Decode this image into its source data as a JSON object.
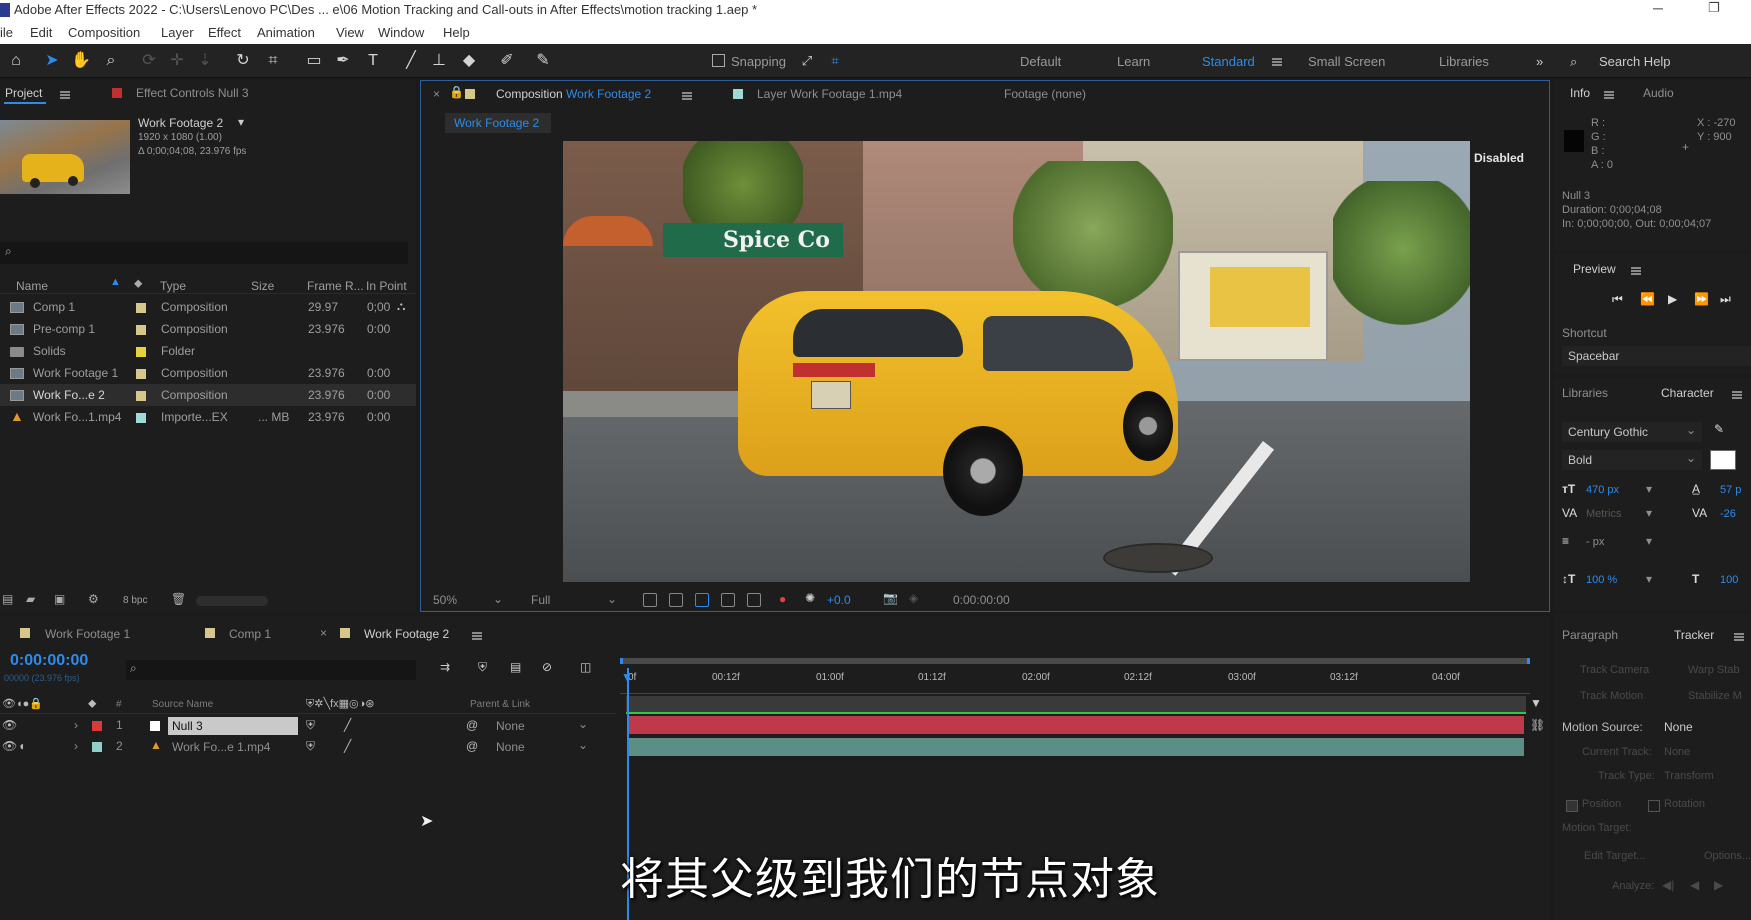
{
  "window": {
    "title": "Adobe After Effects 2022 - C:\\Users\\Lenovo PC\\Des ... e\\06 Motion Tracking and Call-outs in After Effects\\motion tracking 1.aep *"
  },
  "menu": [
    "ile",
    "Edit",
    "Composition",
    "Layer",
    "Effect",
    "Animation",
    "View",
    "Window",
    "Help"
  ],
  "toolbar": {
    "snapping_label": "Snapping",
    "workspaces": [
      "Default",
      "Learn",
      "Standard",
      "Small Screen",
      "Libraries"
    ],
    "active_workspace": "Standard",
    "search_help": "Search Help"
  },
  "project_panel": {
    "tab_project": "Project",
    "tab_effect_controls": "Effect Controls Null 3",
    "selected_name": "Work Footage 2",
    "selected_size": "1920 x 1080 (1.00)",
    "selected_duration": "Δ 0;00;04;08, 23.976 fps",
    "columns": [
      "Name",
      "Type",
      "Size",
      "Frame R...",
      "In Point"
    ],
    "items": [
      {
        "name": "Comp 1",
        "type": "Composition",
        "size": "",
        "rate": "29.97",
        "in": "0;00",
        "color": "#d8c78a",
        "icon": "comp-icon"
      },
      {
        "name": "Pre-comp 1",
        "type": "Composition",
        "size": "",
        "rate": "23.976",
        "in": "0:00",
        "color": "#d8c78a",
        "icon": "comp-icon"
      },
      {
        "name": "Solids",
        "type": "Folder",
        "size": "",
        "rate": "",
        "in": "",
        "color": "#e8d23a",
        "icon": "folder-icon"
      },
      {
        "name": "Work Footage 1",
        "type": "Composition",
        "size": "",
        "rate": "23.976",
        "in": "0:00",
        "color": "#d8c78a",
        "icon": "comp-icon"
      },
      {
        "name": "Work Fo...e 2",
        "type": "Composition",
        "size": "",
        "rate": "23.976",
        "in": "0:00",
        "color": "#d8c78a",
        "icon": "comp-icon"
      },
      {
        "name": "Work Fo...1.mp4",
        "type": "Importe...EX",
        "size": "... MB",
        "rate": "23.976",
        "in": "0:00",
        "color": "#9fd8d4",
        "icon": "footage-icon"
      }
    ],
    "bpc": "8 bpc"
  },
  "composition_panel": {
    "tab_comp_prefix": "Composition",
    "tab_comp_name": "Work Footage 2",
    "tab_layer": "Layer  Work Footage 1.mp4",
    "tab_footage": "Footage  (none)",
    "breadcrumb": "Work Footage 2",
    "disabled_label": "Disabled",
    "zoom": "50%",
    "resolution": "Full",
    "exposure": "+0.0",
    "timecode": "0:00:00:00"
  },
  "info_panel": {
    "tab_info": "Info",
    "tab_audio": "Audio",
    "r": "R :",
    "g": "G :",
    "b": "B :",
    "a": "A : 0",
    "x": "X : -270",
    "y": "Y : 900",
    "layer_name": "Null 3",
    "duration": "Duration: 0;00;04;08",
    "in_out": "In: 0;00;00;00, Out: 0;00;04;07"
  },
  "preview_panel": {
    "title": "Preview",
    "shortcut_label": "Shortcut",
    "shortcut_value": "Spacebar"
  },
  "character_panel": {
    "tab_libraries": "Libraries",
    "tab_character": "Character",
    "font": "Century Gothic",
    "style": "Bold",
    "size": "470 px",
    "leading": "57 p",
    "kerning": "Metrics",
    "tracking": "-26",
    "stroke": "- px",
    "vscale": "100 %",
    "hscale": "100"
  },
  "tracker_panel": {
    "tab_paragraph": "Paragraph",
    "tab_tracker": "Tracker",
    "btn_track_camera": "Track Camera",
    "btn_warp_stab": "Warp Stab",
    "btn_track_motion": "Track Motion",
    "btn_stabilize": "Stabilize M",
    "motion_source_label": "Motion Source:",
    "motion_source_value": "None",
    "current_track_label": "Current Track:",
    "current_track_value": "None",
    "track_type_label": "Track Type:",
    "track_type_value": "Transform",
    "position": "Position",
    "rotation": "Rotation",
    "motion_target": "Motion Target:",
    "edit_target": "Edit Target...",
    "options": "Options...",
    "analyze": "Analyze:"
  },
  "timeline": {
    "tabs": [
      "Work Footage 1",
      "Comp 1",
      "Work Footage 2"
    ],
    "active_tab": "Work Footage 2",
    "timecode": "0:00:00:00",
    "timecode_sub": "00000 (23.976 fps)",
    "col_source_name": "Source Name",
    "col_parent": "Parent & Link",
    "ruler": [
      "0f",
      "00:12f",
      "01:00f",
      "01:12f",
      "02:00f",
      "02:12f",
      "03:00f",
      "03:12f",
      "04:00f"
    ],
    "layers": [
      {
        "num": "1",
        "name": "Null 3",
        "color": "#d83a3a",
        "parent": "None",
        "bar": "#c0394a"
      },
      {
        "num": "2",
        "name": "Work Fo...e 1.mp4",
        "color": "#8fd0c8",
        "parent": "None",
        "bar": "#5d8e85"
      }
    ]
  },
  "subtitle": "将其父级到我们的节点对象",
  "video": {
    "sign_text": "Spice Co"
  }
}
